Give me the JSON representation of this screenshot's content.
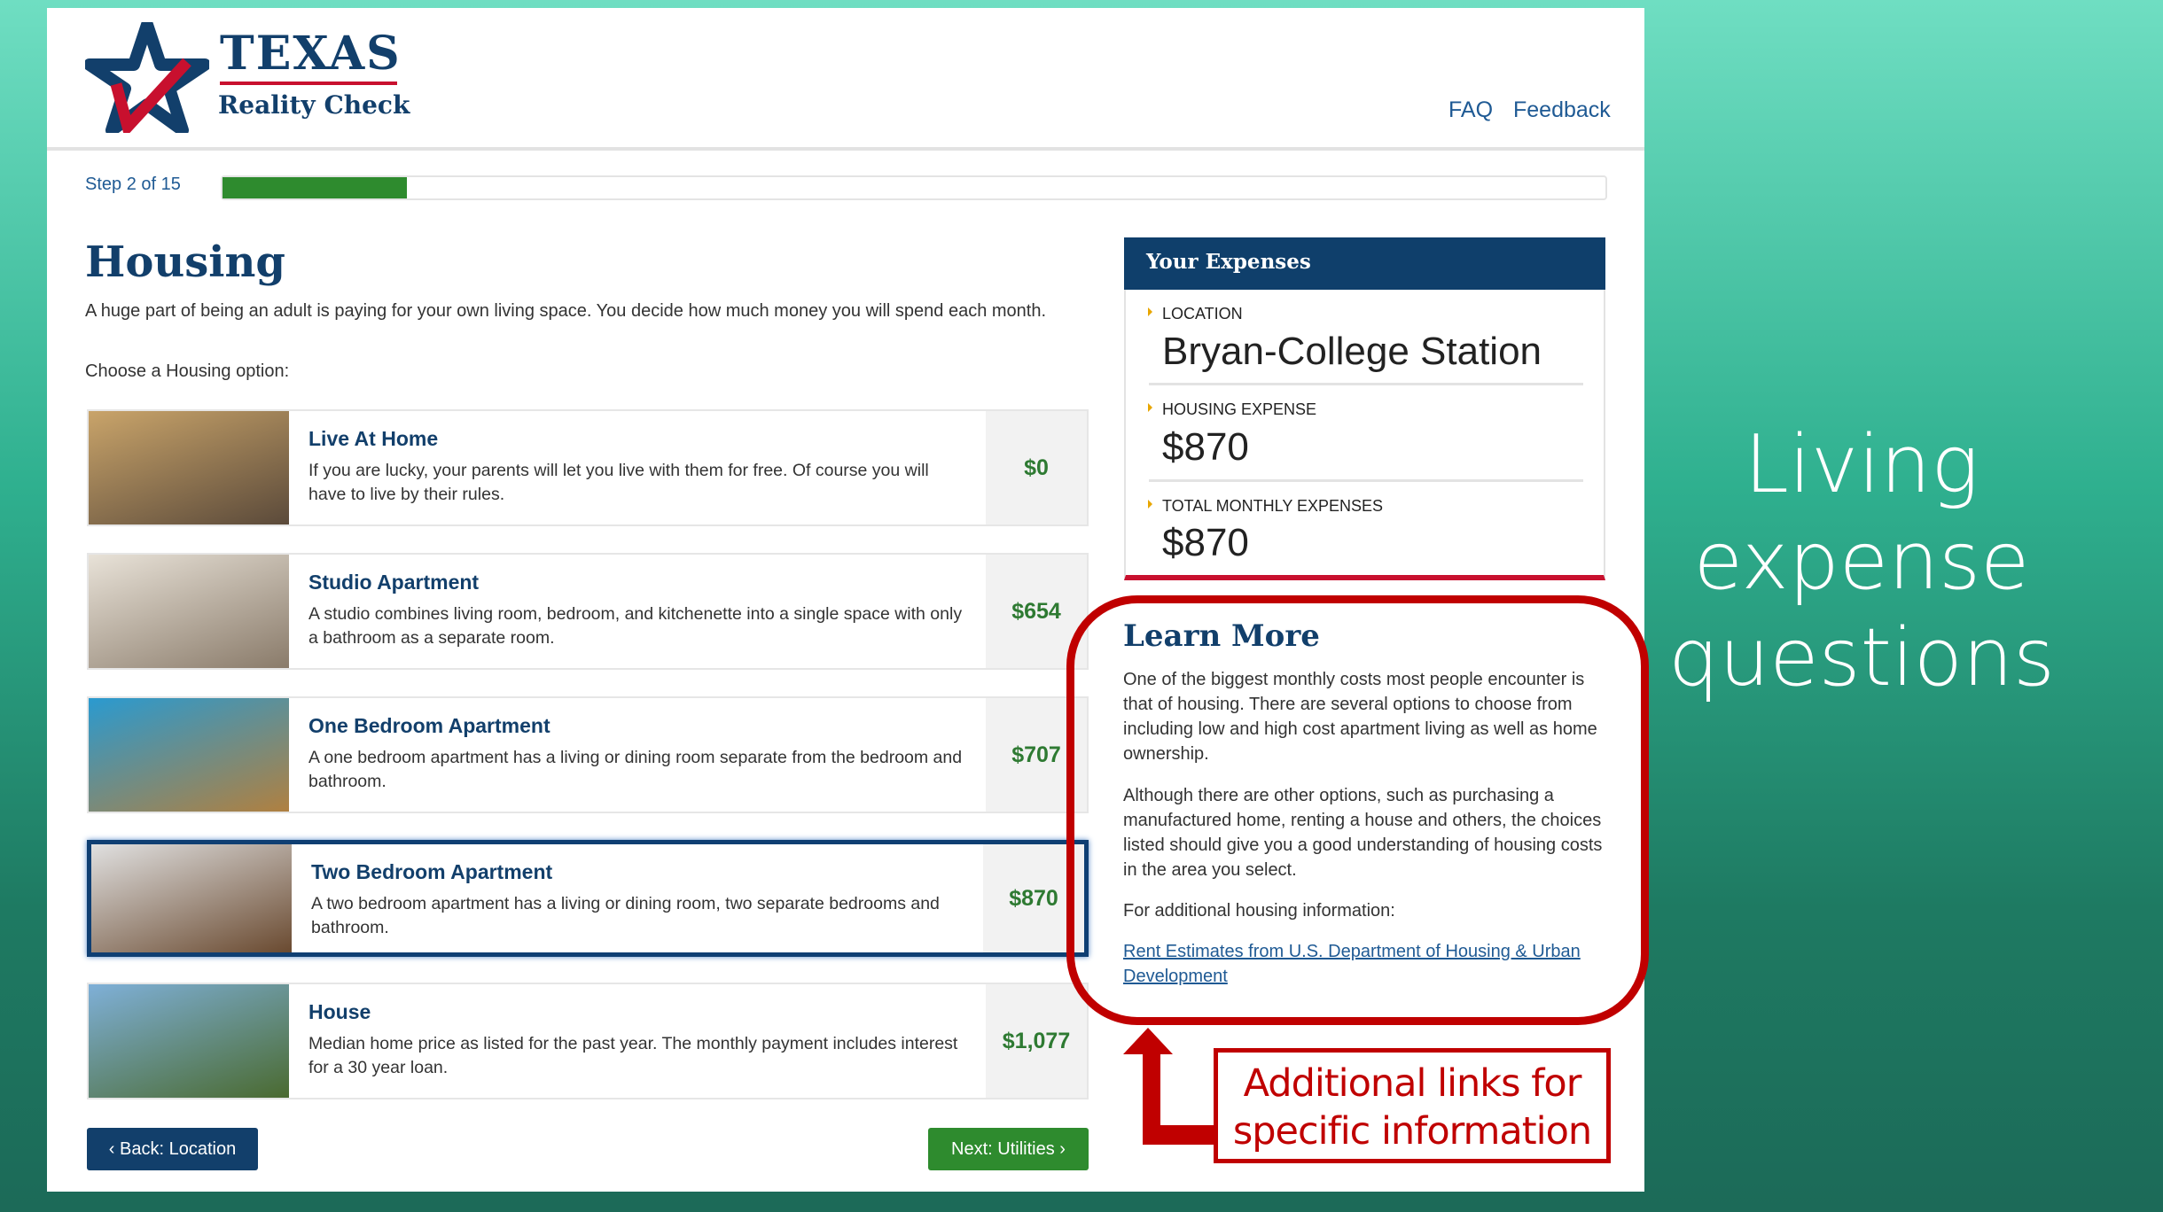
{
  "header": {
    "logo_title": "TEXAS",
    "logo_subtitle": "Reality Check",
    "nav": [
      "FAQ",
      "Feedback"
    ]
  },
  "progress": {
    "label": "Step 2 of 15",
    "current": 2,
    "total": 15,
    "color": "#2e8b2e"
  },
  "page": {
    "title": "Housing",
    "intro": "A huge part of being an adult is paying for your own living space. You decide how much money you will spend each month.",
    "prompt": "Choose a Housing option:"
  },
  "options": [
    {
      "title": "Live At Home",
      "desc": "If you are lucky, your parents will let you live with them for free. Of course you will have to live by their rules.",
      "price": "$0",
      "selected": false
    },
    {
      "title": "Studio Apartment",
      "desc": "A studio combines living room, bedroom, and kitchenette into a single space with only a bathroom as a separate room.",
      "price": "$654",
      "selected": false
    },
    {
      "title": "One Bedroom Apartment",
      "desc": "A one bedroom apartment has a living or dining room separate from the bedroom and bathroom.",
      "price": "$707",
      "selected": false
    },
    {
      "title": "Two Bedroom Apartment",
      "desc": "A two bedroom apartment has a living or dining room, two separate bedrooms and bathroom.",
      "price": "$870",
      "selected": true
    },
    {
      "title": "House",
      "desc": "Median home price as listed for the past year. The monthly payment includes interest for a 30 year loan.",
      "price": "$1,077",
      "selected": false
    }
  ],
  "buttons": {
    "back": "Back: Location",
    "next": "Next: Utilities"
  },
  "expenses": {
    "title": "Your Expenses",
    "location_label": "LOCATION",
    "location": "Bryan-College Station",
    "housing_label": "HOUSING EXPENSE",
    "housing": "$870",
    "total_label": "TOTAL MONTHLY EXPENSES",
    "total": "$870"
  },
  "learn_more": {
    "title": "Learn More",
    "p1": "One of the biggest monthly costs most people encounter is that of housing. There are several options to choose from including low and high cost apartment living as well as home ownership.",
    "p2": "Although there are other options, such as purchasing a manufactured home, renting a house and others, the choices listed should give you a good understanding of housing costs in the area you select.",
    "p3": "For additional housing information:",
    "link": "Rent Estimates from U.S. Department of Housing & Urban Development"
  },
  "annotation": {
    "callout": "Additional links for specific information",
    "color": "#c00000"
  },
  "slide_title": "Living expense questions"
}
